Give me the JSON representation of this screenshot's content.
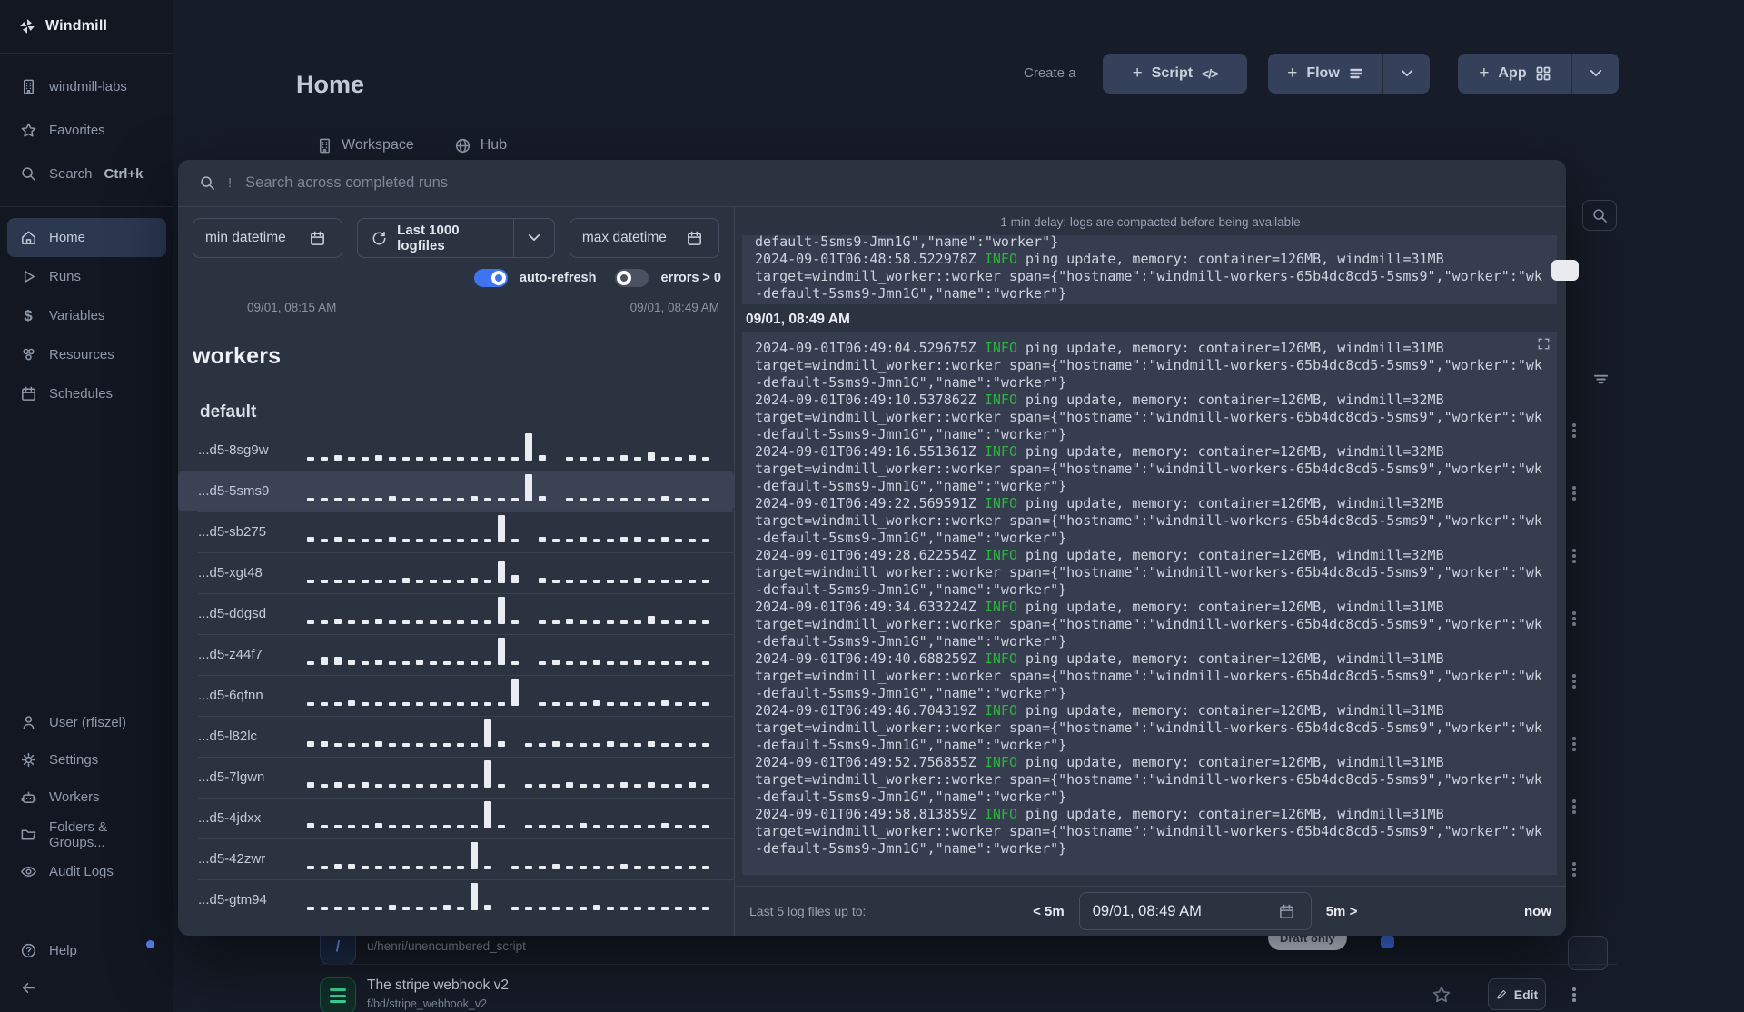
{
  "sidebar": {
    "app_name": "Windmill",
    "workspace_item": "windmill-labs",
    "favorites_item": "Favorites",
    "search_item": "Search",
    "search_shortcut": "Ctrl+k",
    "nav": [
      {
        "label": "Home",
        "active": true
      },
      {
        "label": "Runs"
      },
      {
        "label": "Variables"
      },
      {
        "label": "Resources"
      },
      {
        "label": "Schedules"
      }
    ],
    "bottom": [
      {
        "label": "User (rfiszel)"
      },
      {
        "label": "Settings"
      },
      {
        "label": "Workers"
      },
      {
        "label": "Folders & Groups..."
      },
      {
        "label": "Audit Logs"
      }
    ],
    "help_label": "Help"
  },
  "header": {
    "title": "Home",
    "create_label": "Create a",
    "script_button": "Script",
    "flow_button": "Flow",
    "app_button": "App",
    "tab_workspace": "Workspace",
    "tab_hub": "Hub"
  },
  "modal": {
    "search_prefix": "!",
    "search_placeholder": "Search across completed runs",
    "min_datetime_placeholder": "min datetime",
    "logfiles_button": "Last 1000 logfiles",
    "max_datetime_placeholder": "max datetime",
    "auto_refresh_label": "auto-refresh",
    "errors_label": "errors > 0",
    "range_start": "09/01, 08:15 AM",
    "range_end": "09/01, 08:49 AM",
    "workers_title": "workers",
    "group_title": "default",
    "workers": [
      {
        "name": "...d5-8sg9w",
        "selected": false,
        "bars": [
          1,
          1,
          2,
          1,
          1,
          2,
          1,
          1,
          1,
          1,
          1,
          1,
          1,
          1,
          1,
          1,
          10,
          2,
          0,
          1,
          1,
          1,
          1,
          2,
          1,
          3,
          1,
          1,
          2,
          1
        ]
      },
      {
        "name": "...d5-5sms9",
        "selected": true,
        "bars": [
          1,
          1,
          1,
          1,
          1,
          1,
          2,
          1,
          1,
          1,
          1,
          1,
          2,
          1,
          1,
          1,
          10,
          2,
          0,
          1,
          1,
          1,
          1,
          1,
          1,
          1,
          2,
          1,
          1,
          1
        ]
      },
      {
        "name": "...d5-sb275",
        "selected": false,
        "bars": [
          2,
          1,
          2,
          1,
          1,
          1,
          2,
          1,
          1,
          1,
          1,
          1,
          1,
          1,
          10,
          1,
          0,
          2,
          1,
          1,
          2,
          1,
          1,
          2,
          2,
          1,
          2,
          1,
          1,
          1
        ]
      },
      {
        "name": "...d5-xgt48",
        "selected": false,
        "bars": [
          1,
          1,
          1,
          1,
          1,
          1,
          1,
          2,
          1,
          1,
          1,
          1,
          2,
          1,
          8,
          3,
          0,
          2,
          1,
          1,
          1,
          1,
          1,
          1,
          2,
          1,
          1,
          1,
          1,
          1
        ]
      },
      {
        "name": "...d5-ddgsd",
        "selected": false,
        "bars": [
          1,
          1,
          2,
          1,
          1,
          2,
          1,
          1,
          1,
          1,
          1,
          1,
          1,
          1,
          10,
          1,
          0,
          1,
          1,
          2,
          1,
          1,
          1,
          1,
          1,
          3,
          1,
          1,
          1,
          1
        ]
      },
      {
        "name": "...d5-z44f7",
        "selected": false,
        "bars": [
          1,
          3,
          3,
          2,
          1,
          2,
          1,
          1,
          2,
          1,
          1,
          1,
          1,
          1,
          10,
          1,
          0,
          1,
          2,
          1,
          1,
          2,
          1,
          1,
          2,
          1,
          1,
          1,
          1,
          1
        ]
      },
      {
        "name": "...d5-6qfnn",
        "selected": false,
        "bars": [
          1,
          1,
          1,
          2,
          1,
          1,
          1,
          1,
          1,
          1,
          1,
          1,
          1,
          1,
          1,
          10,
          0,
          1,
          1,
          1,
          1,
          2,
          1,
          1,
          1,
          1,
          2,
          1,
          1,
          1
        ]
      },
      {
        "name": "...d5-l82lc",
        "selected": false,
        "bars": [
          2,
          2,
          1,
          1,
          1,
          2,
          1,
          1,
          1,
          1,
          1,
          1,
          1,
          10,
          2,
          0,
          1,
          1,
          2,
          1,
          1,
          1,
          2,
          1,
          1,
          2,
          1,
          1,
          1,
          1
        ]
      },
      {
        "name": "...d5-7lgwn",
        "selected": false,
        "bars": [
          2,
          1,
          2,
          1,
          2,
          1,
          1,
          1,
          1,
          1,
          1,
          1,
          1,
          10,
          1,
          0,
          1,
          1,
          1,
          2,
          1,
          1,
          1,
          2,
          1,
          2,
          1,
          1,
          2,
          1
        ]
      },
      {
        "name": "...d5-4jdxx",
        "selected": false,
        "bars": [
          2,
          1,
          1,
          1,
          1,
          2,
          1,
          1,
          1,
          1,
          1,
          1,
          1,
          10,
          1,
          0,
          1,
          1,
          1,
          1,
          2,
          1,
          1,
          1,
          1,
          1,
          2,
          1,
          1,
          1
        ]
      },
      {
        "name": "...d5-42zwr",
        "selected": false,
        "bars": [
          1,
          1,
          2,
          2,
          1,
          1,
          1,
          1,
          1,
          1,
          1,
          1,
          10,
          1,
          0,
          1,
          1,
          1,
          2,
          1,
          1,
          1,
          1,
          2,
          1,
          1,
          1,
          1,
          1,
          1
        ]
      },
      {
        "name": "...d5-gtm94",
        "selected": false,
        "bars": [
          1,
          1,
          1,
          1,
          1,
          1,
          2,
          1,
          1,
          1,
          2,
          1,
          10,
          2,
          0,
          1,
          1,
          1,
          1,
          1,
          1,
          2,
          1,
          1,
          1,
          1,
          1,
          1,
          1,
          1
        ]
      }
    ],
    "log": {
      "delay_note": "1 min delay: logs are compacted before being available",
      "clipped_line": "default-5sms9-Jmn1G\",\"name\":\"worker\"}",
      "previous": {
        "ts": "2024-09-01T06:48:58.522978Z",
        "level": "INFO",
        "msg": "ping update, memory: container=126MB, windmill=31MB",
        "target": "target=windmill_worker::worker span={\"hostname\":\"windmill-workers-65b4dc8cd5-5sms9\",\"worker\":\"wk-default-5sms9-Jmn1G\",\"name\":\"worker\"}"
      },
      "date_header": "09/01, 08:49 AM",
      "entries": [
        {
          "ts": "2024-09-01T06:49:04.529675Z",
          "level": "INFO",
          "msg": "ping update, memory: container=126MB, windmill=31MB",
          "target": "target=windmill_worker::worker span={\"hostname\":\"windmill-workers-65b4dc8cd5-5sms9\",\"worker\":\"wk-default-5sms9-Jmn1G\",\"name\":\"worker\"}"
        },
        {
          "ts": "2024-09-01T06:49:10.537862Z",
          "level": "INFO",
          "msg": "ping update, memory: container=126MB, windmill=32MB",
          "target": "target=windmill_worker::worker span={\"hostname\":\"windmill-workers-65b4dc8cd5-5sms9\",\"worker\":\"wk-default-5sms9-Jmn1G\",\"name\":\"worker\"}"
        },
        {
          "ts": "2024-09-01T06:49:16.551361Z",
          "level": "INFO",
          "msg": "ping update, memory: container=126MB, windmill=32MB",
          "target": "target=windmill_worker::worker span={\"hostname\":\"windmill-workers-65b4dc8cd5-5sms9\",\"worker\":\"wk-default-5sms9-Jmn1G\",\"name\":\"worker\"}"
        },
        {
          "ts": "2024-09-01T06:49:22.569591Z",
          "level": "INFO",
          "msg": "ping update, memory: container=126MB, windmill=32MB",
          "target": "target=windmill_worker::worker span={\"hostname\":\"windmill-workers-65b4dc8cd5-5sms9\",\"worker\":\"wk-default-5sms9-Jmn1G\",\"name\":\"worker\"}"
        },
        {
          "ts": "2024-09-01T06:49:28.622554Z",
          "level": "INFO",
          "msg": "ping update, memory: container=126MB, windmill=32MB",
          "target": "target=windmill_worker::worker span={\"hostname\":\"windmill-workers-65b4dc8cd5-5sms9\",\"worker\":\"wk-default-5sms9-Jmn1G\",\"name\":\"worker\"}"
        },
        {
          "ts": "2024-09-01T06:49:34.633224Z",
          "level": "INFO",
          "msg": "ping update, memory: container=126MB, windmill=31MB",
          "target": "target=windmill_worker::worker span={\"hostname\":\"windmill-workers-65b4dc8cd5-5sms9\",\"worker\":\"wk-default-5sms9-Jmn1G\",\"name\":\"worker\"}"
        },
        {
          "ts": "2024-09-01T06:49:40.688259Z",
          "level": "INFO",
          "msg": "ping update, memory: container=126MB, windmill=31MB",
          "target": "target=windmill_worker::worker span={\"hostname\":\"windmill-workers-65b4dc8cd5-5sms9\",\"worker\":\"wk-default-5sms9-Jmn1G\",\"name\":\"worker\"}"
        },
        {
          "ts": "2024-09-01T06:49:46.704319Z",
          "level": "INFO",
          "msg": "ping update, memory: container=126MB, windmill=31MB",
          "target": "target=windmill_worker::worker span={\"hostname\":\"windmill-workers-65b4dc8cd5-5sms9\",\"worker\":\"wk-default-5sms9-Jmn1G\",\"name\":\"worker\"}"
        },
        {
          "ts": "2024-09-01T06:49:52.756855Z",
          "level": "INFO",
          "msg": "ping update, memory: container=126MB, windmill=31MB",
          "target": "target=windmill_worker::worker span={\"hostname\":\"windmill-workers-65b4dc8cd5-5sms9\",\"worker\":\"wk-default-5sms9-Jmn1G\",\"name\":\"worker\"}"
        },
        {
          "ts": "2024-09-01T06:49:58.813859Z",
          "level": "INFO",
          "msg": "ping update, memory: container=126MB, windmill=31MB",
          "target": "target=windmill_worker::worker span={\"hostname\":\"windmill-workers-65b4dc8cd5-5sms9\",\"worker\":\"wk-default-5sms9-Jmn1G\",\"name\":\"worker\"}"
        }
      ],
      "footer": {
        "label": "Last 5 log files up to:",
        "back": "< 5m",
        "datetime": "09/01, 08:49 AM",
        "forward": "5m >",
        "now": "now"
      }
    }
  },
  "background": {
    "row_a_path": "u/henri/unencumbered_script",
    "row_a_badge": "Draft only",
    "row_b_title": "The stripe webhook v2",
    "row_b_path": "f/bd/stripe_webhook_v2",
    "edit_label": "Edit"
  }
}
